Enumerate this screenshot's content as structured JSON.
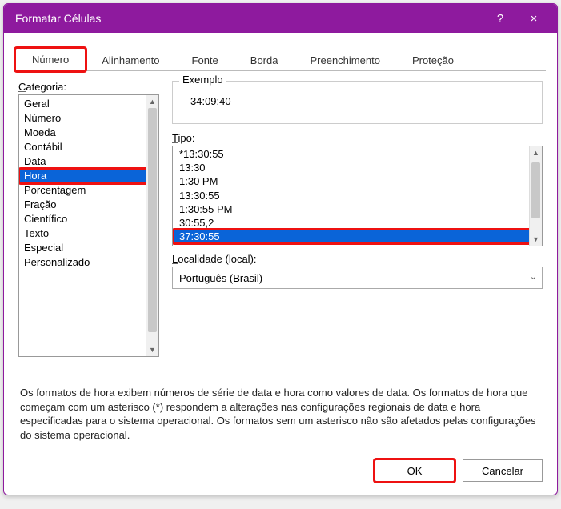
{
  "titlebar": {
    "title": "Formatar Células",
    "help": "?",
    "close": "×"
  },
  "tabs": [
    {
      "label": "Número",
      "active": true
    },
    {
      "label": "Alinhamento"
    },
    {
      "label": "Fonte"
    },
    {
      "label": "Borda"
    },
    {
      "label": "Preenchimento"
    },
    {
      "label": "Proteção"
    }
  ],
  "category": {
    "label": "Categoria:",
    "items": [
      "Geral",
      "Número",
      "Moeda",
      "Contábil",
      "Data",
      "Hora",
      "Porcentagem",
      "Fração",
      "Científico",
      "Texto",
      "Especial",
      "Personalizado"
    ],
    "selected": "Hora"
  },
  "example": {
    "label": "Exemplo",
    "value": "34:09:40"
  },
  "type": {
    "label": "Tipo:",
    "items": [
      "*13:30:55",
      "13:30",
      "1:30 PM",
      "13:30:55",
      "1:30:55 PM",
      "30:55,2",
      "37:30:55"
    ],
    "selected": "37:30:55"
  },
  "locale": {
    "label": "Localidade (local):",
    "value": "Português (Brasil)"
  },
  "description": "Os formatos de hora exibem números de série de data e hora como valores de data. Os formatos de hora que começam com um asterisco (*) respondem a alterações nas configurações regionais de data e hora especificadas para o sistema operacional. Os formatos sem um asterisco não são afetados pelas configurações do sistema operacional.",
  "buttons": {
    "ok": "OK",
    "cancel": "Cancelar"
  }
}
